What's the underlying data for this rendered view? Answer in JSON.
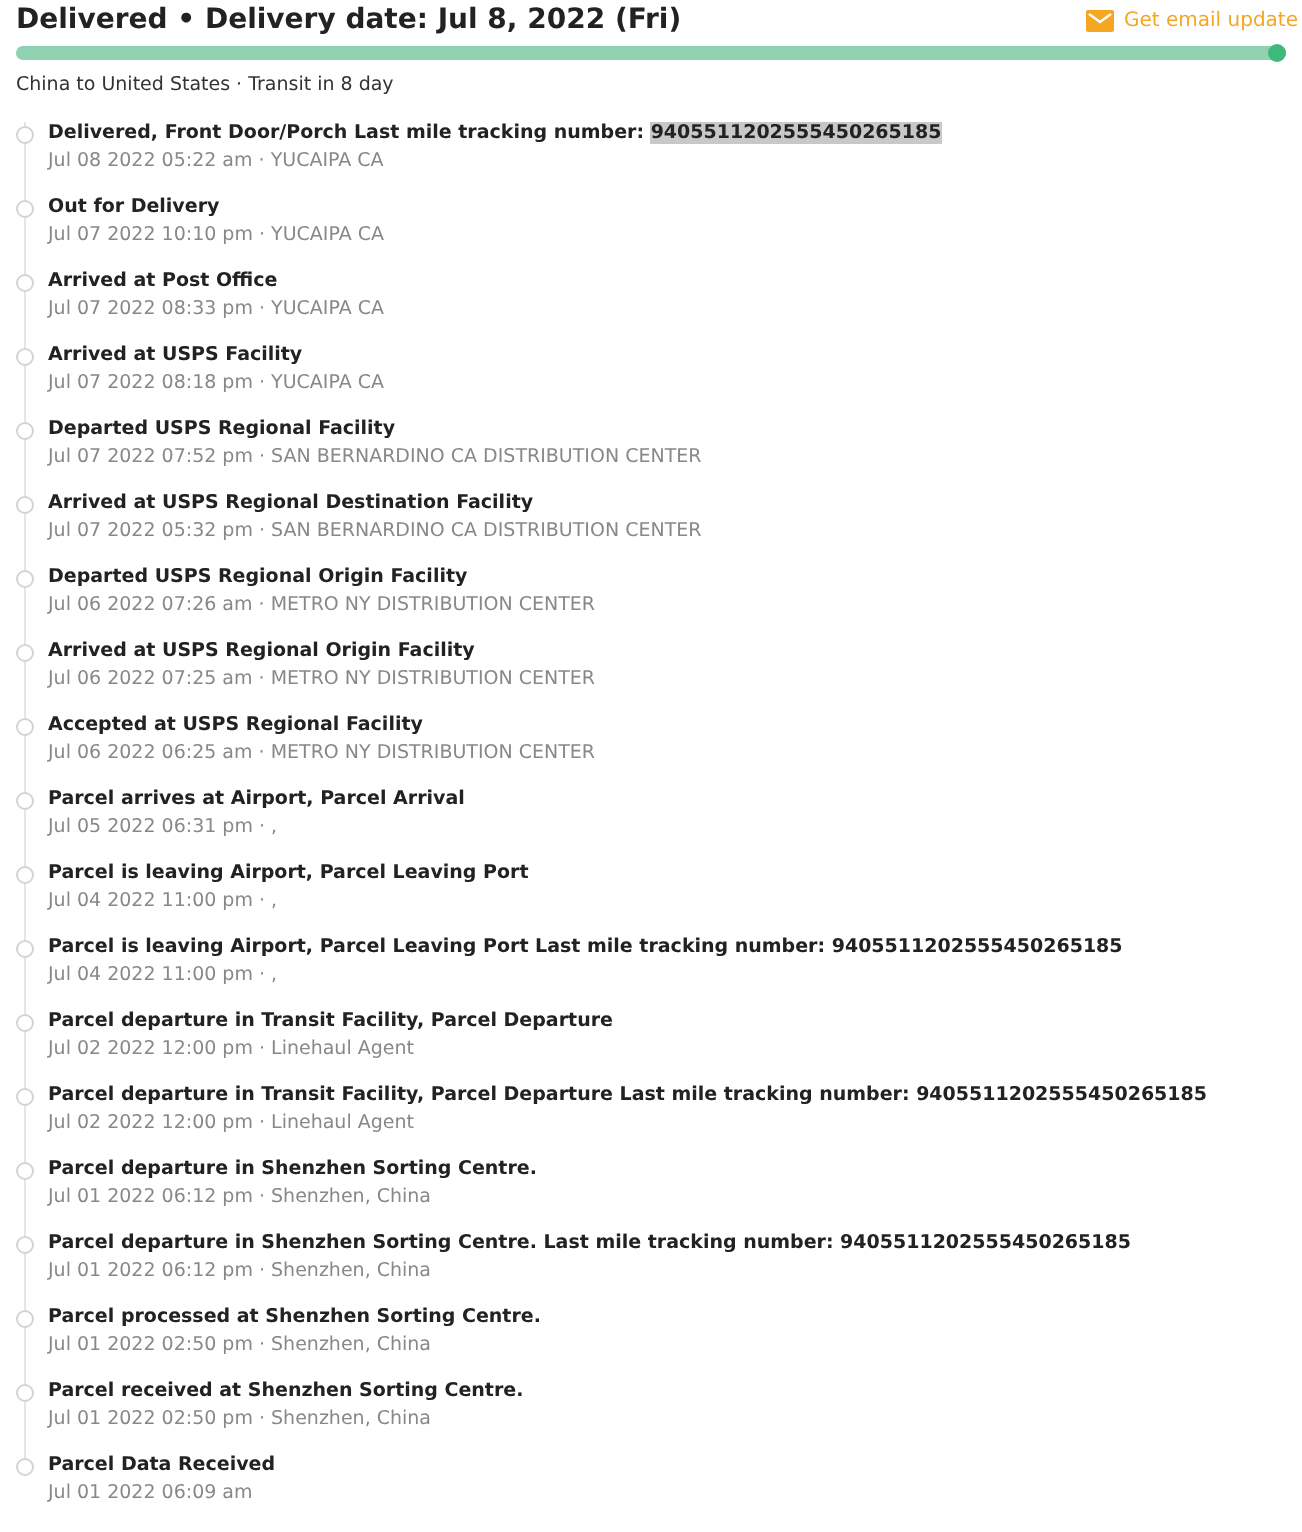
{
  "header": {
    "title": "Delivered • Delivery date: Jul 8, 2022 (Fri)",
    "email_link": "Get email update"
  },
  "progress": {
    "level": 1
  },
  "route": "China to United States · Transit in 8 day",
  "events": [
    {
      "title": "Delivered, Front Door/Porch Last mile tracking number:",
      "highlight": "9405511202555450265185",
      "detail": "Jul 08 2022 05:22 am · YUCAIPA CA"
    },
    {
      "title": "Out for Delivery",
      "detail": "Jul 07 2022 10:10 pm · YUCAIPA CA"
    },
    {
      "title": "Arrived at Post Office",
      "detail": "Jul 07 2022 08:33 pm · YUCAIPA CA"
    },
    {
      "title": "Arrived at USPS Facility",
      "detail": "Jul 07 2022 08:18 pm · YUCAIPA CA"
    },
    {
      "title": "Departed USPS Regional Facility",
      "detail": "Jul 07 2022 07:52 pm · SAN BERNARDINO CA DISTRIBUTION CENTER"
    },
    {
      "title": "Arrived at USPS Regional Destination Facility",
      "detail": "Jul 07 2022 05:32 pm · SAN BERNARDINO CA DISTRIBUTION CENTER"
    },
    {
      "title": "Departed USPS Regional Origin Facility",
      "detail": "Jul 06 2022 07:26 am · METRO NY DISTRIBUTION CENTER"
    },
    {
      "title": "Arrived at USPS Regional Origin Facility",
      "detail": "Jul 06 2022 07:25 am · METRO NY DISTRIBUTION CENTER"
    },
    {
      "title": "Accepted at USPS Regional Facility",
      "detail": "Jul 06 2022 06:25 am · METRO NY DISTRIBUTION CENTER"
    },
    {
      "title": "Parcel arrives at Airport, Parcel Arrival",
      "detail": "Jul 05 2022 06:31 pm · ,"
    },
    {
      "title": "Parcel is leaving Airport, Parcel Leaving Port",
      "detail": "Jul 04 2022 11:00 pm · ,"
    },
    {
      "title": "Parcel is leaving Airport, Parcel Leaving Port Last mile tracking number: 9405511202555450265185",
      "detail": "Jul 04 2022 11:00 pm · ,"
    },
    {
      "title": "Parcel departure in Transit Facility, Parcel Departure",
      "detail": "Jul 02 2022 12:00 pm · Linehaul Agent"
    },
    {
      "title": "Parcel departure in Transit Facility, Parcel Departure Last mile tracking number: 9405511202555450265185",
      "detail": "Jul 02 2022 12:00 pm · Linehaul Agent"
    },
    {
      "title": "Parcel departure in Shenzhen Sorting Centre.",
      "detail": "Jul 01 2022 06:12 pm · Shenzhen, China"
    },
    {
      "title": "Parcel departure in Shenzhen Sorting Centre. Last mile tracking number: 9405511202555450265185",
      "detail": "Jul 01 2022 06:12 pm · Shenzhen, China"
    },
    {
      "title": "Parcel processed at Shenzhen Sorting Centre.",
      "detail": "Jul 01 2022 02:50 pm · Shenzhen, China"
    },
    {
      "title": "Parcel received at Shenzhen Sorting Centre.",
      "detail": "Jul 01 2022 02:50 pm · Shenzhen, China"
    },
    {
      "title": "Parcel Data Received",
      "detail": "Jul 01 2022 06:09 am"
    }
  ]
}
